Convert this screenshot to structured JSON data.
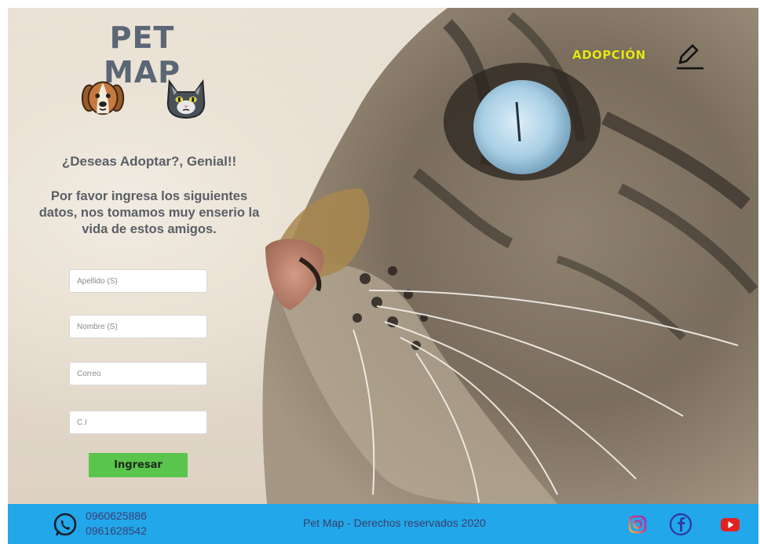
{
  "brand": {
    "name": "PET MAP"
  },
  "icons": {
    "dog": "dog-face-icon",
    "cat": "cat-face-icon",
    "edit": "pencil-icon",
    "whatsapp": "whatsapp-icon",
    "instagram": "instagram-icon",
    "facebook": "facebook-icon",
    "youtube": "youtube-icon"
  },
  "nav": {
    "adopcion": "ADOPCIÓN"
  },
  "intro": {
    "heading": "¿Deseas Adoptar?, Genial!!",
    "description": "Por favor ingresa los siguientes datos, nos tomamos muy enserio la vida de estos amigos."
  },
  "form": {
    "apellido_placeholder": "Apellido (S)",
    "nombre_placeholder": "Nombre (S)",
    "correo_placeholder": "Correo",
    "ci_placeholder": "C.I",
    "submit_label": "Ingresar"
  },
  "footer": {
    "phone_1": "0960625886",
    "phone_2": "0961628542",
    "copyright": "Pet Map - Derechos reservados 2020"
  },
  "colors": {
    "footer_bg": "#22a7ea",
    "nav_accent": "#e8e615",
    "submit_bg": "#5ac44c",
    "brand_text": "#5b6676"
  }
}
